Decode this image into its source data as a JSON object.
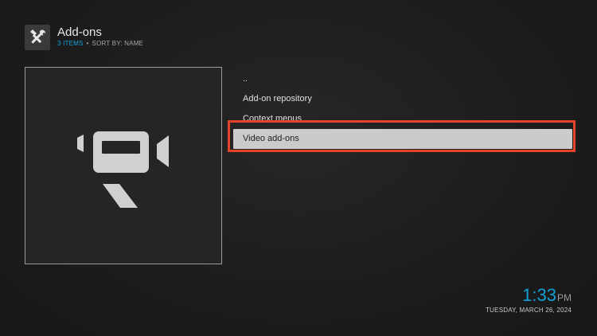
{
  "header": {
    "icon": "tools-icon",
    "title": "Add-ons",
    "item_count": "3 ITEMS",
    "separator": "•",
    "sort_label": "SORT BY: NAME"
  },
  "preview": {
    "icon": "video-camera-icon"
  },
  "list": {
    "items": [
      {
        "label": ".."
      },
      {
        "label": "Add-on repository"
      },
      {
        "label": "Context menus"
      },
      {
        "label": "Video add-ons"
      }
    ],
    "selected_label": "Video add-ons"
  },
  "clock": {
    "time": "1:33",
    "ampm": "PM",
    "date": "TUESDAY, MARCH 26, 2024"
  },
  "colors": {
    "accent": "#12a0d7",
    "highlight": "#e4452a",
    "selected_bg": "#cbcbcb"
  }
}
